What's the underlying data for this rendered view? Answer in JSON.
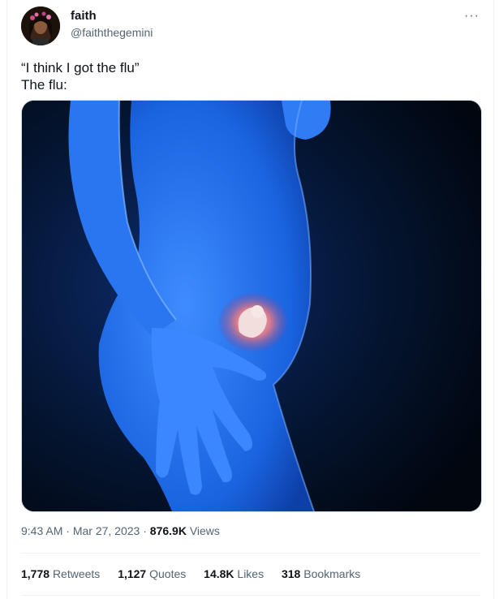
{
  "author": {
    "display_name": "faith",
    "handle": "@faiththegemini"
  },
  "menu_icon": "more-dots-icon",
  "tweet": {
    "line1": "“I think I got the flu”",
    "line2": "The flu:"
  },
  "meta": {
    "time": "9:43 AM",
    "separator1": " · ",
    "date": "Mar 27, 2023",
    "separator2": " · ",
    "views_count": "876.9K",
    "views_label": "Views"
  },
  "stats": {
    "retweets_count": "1,778",
    "retweets_label": "Retweets",
    "quotes_count": "1,127",
    "quotes_label": "Quotes",
    "likes_count": "14.8K",
    "likes_label": "Likes",
    "bookmarks_count": "318",
    "bookmarks_label": "Bookmarks"
  },
  "colors": {
    "text_primary": "#0f1419",
    "text_secondary": "#536471",
    "image_body_blue": "#1f73e6",
    "image_background": "#020a18"
  }
}
